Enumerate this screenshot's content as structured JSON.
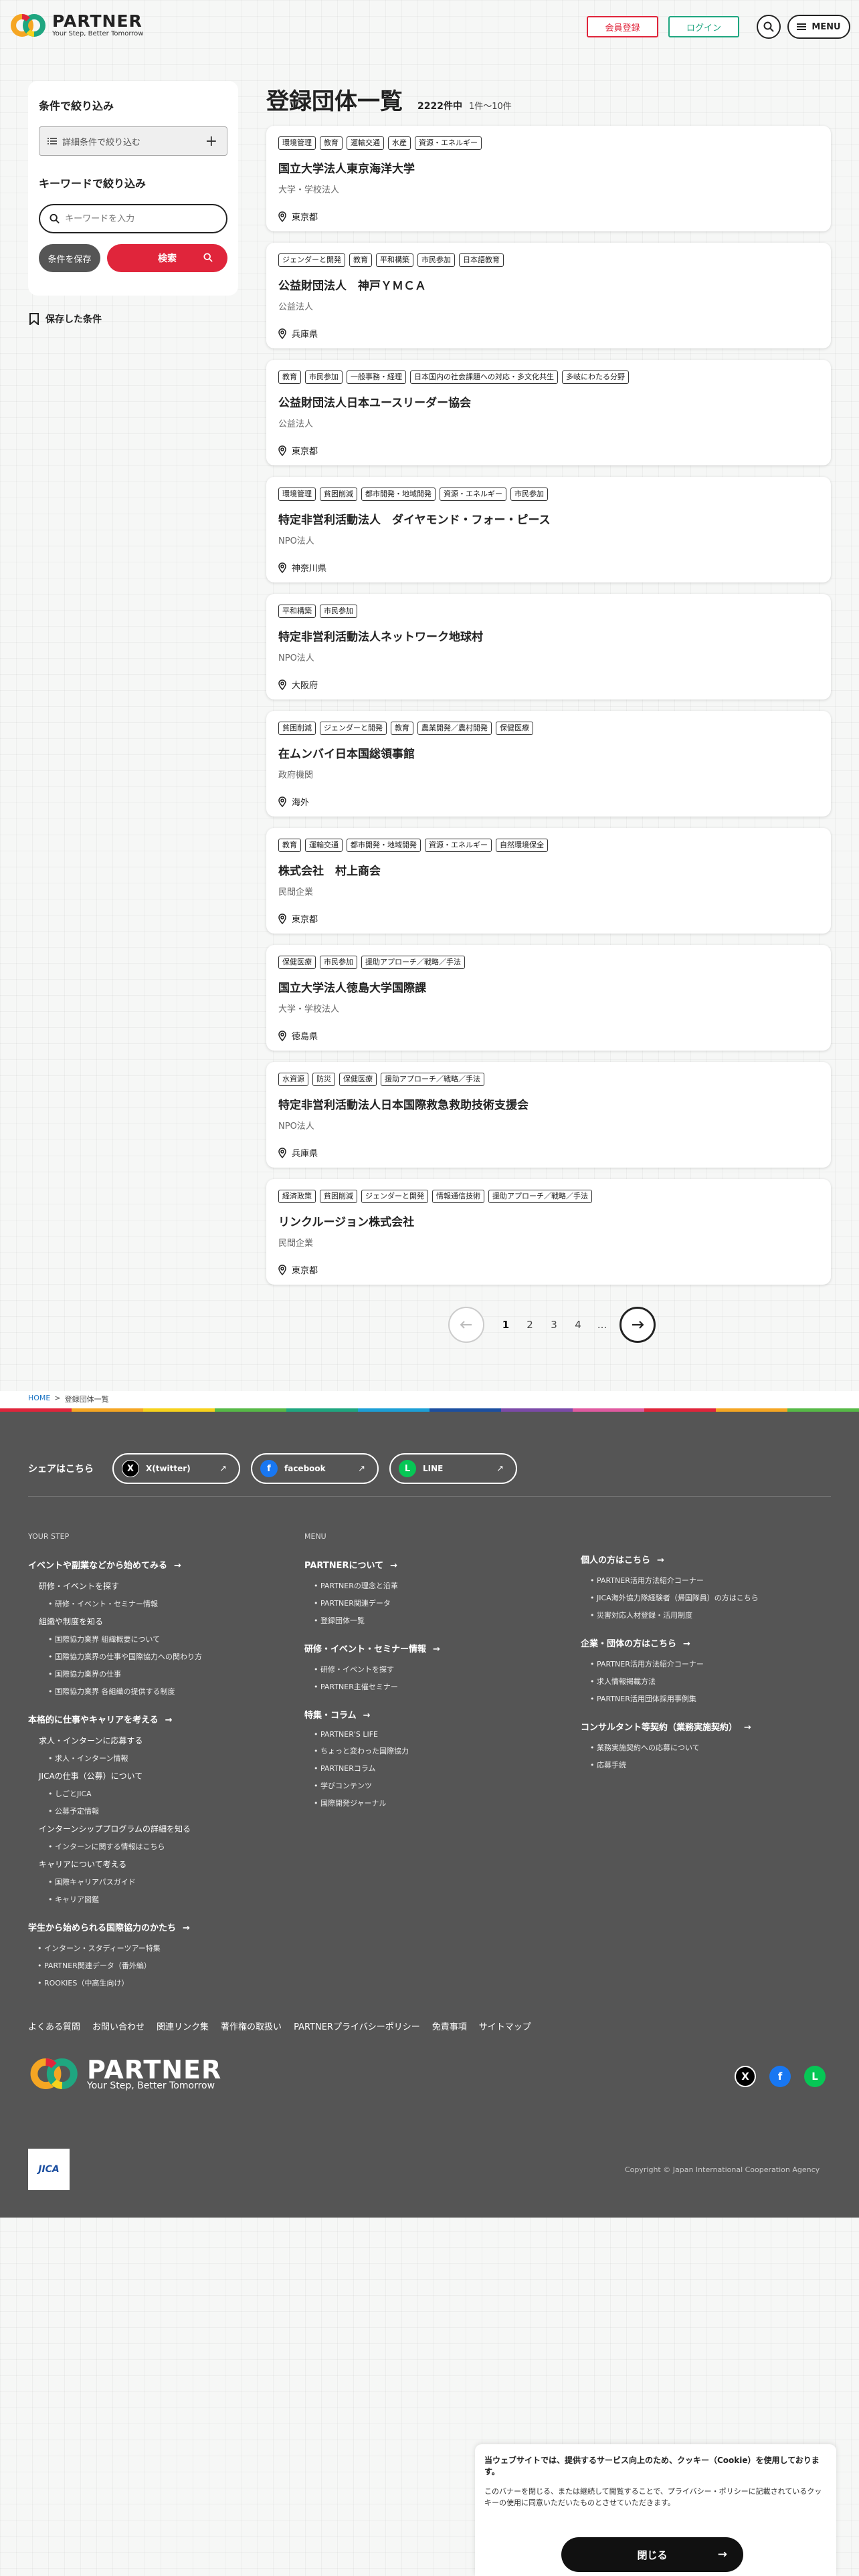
{
  "brand": {
    "name": "PARTNER",
    "tagline": "Your Step, Better Tomorrow"
  },
  "header": {
    "register_label": "会員登録",
    "login_label": "ログイン",
    "menu_label": "MENU"
  },
  "sidebar": {
    "filter_title": "条件で絞り込み",
    "detail_label": "詳細条件で絞り込む",
    "keyword_title": "キーワードで絞り込み",
    "keyword_placeholder": "キーワードを入力",
    "save_label": "条件を保存",
    "search_label": "検索",
    "saved_label": "保存した条件"
  },
  "main": {
    "title": "登録団体一覧",
    "count": "2222件中",
    "range": "1件～10件"
  },
  "cards": [
    {
      "tags": [
        "環境管理",
        "教育",
        "運輸交通",
        "水産",
        "資源・エネルギー"
      ],
      "name": "国立大学法人東京海洋大学",
      "type": "大学・学校法人",
      "location": "東京都"
    },
    {
      "tags": [
        "ジェンダーと開発",
        "教育",
        "平和構築",
        "市民参加",
        "日本語教育"
      ],
      "name": "公益財団法人　神戸ＹＭＣＡ",
      "type": "公益法人",
      "location": "兵庫県"
    },
    {
      "tags": [
        "教育",
        "市民参加",
        "一般事務・経理",
        "日本国内の社会課題への対応・多文化共生",
        "多岐にわたる分野"
      ],
      "name": "公益財団法人日本ユースリーダー協会",
      "type": "公益法人",
      "location": "東京都"
    },
    {
      "tags": [
        "環境管理",
        "貧困削減",
        "都市開発・地域開発",
        "資源・エネルギー",
        "市民参加"
      ],
      "name": "特定非営利活動法人　ダイヤモンド・フォー・ピース",
      "type": "NPO法人",
      "location": "神奈川県"
    },
    {
      "tags": [
        "平和構築",
        "市民参加"
      ],
      "name": "特定非営利活動法人ネットワーク地球村",
      "type": "NPO法人",
      "location": "大阪府"
    },
    {
      "tags": [
        "貧困削減",
        "ジェンダーと開発",
        "教育",
        "農業開発／農村開発",
        "保健医療"
      ],
      "name": "在ムンバイ日本国総領事館",
      "type": "政府機関",
      "location": "海外"
    },
    {
      "tags": [
        "教育",
        "運輸交通",
        "都市開発・地域開発",
        "資源・エネルギー",
        "自然環境保全"
      ],
      "name": "株式会社　村上商会",
      "type": "民間企業",
      "location": "東京都"
    },
    {
      "tags": [
        "保健医療",
        "市民参加",
        "援助アプローチ／戦略／手法"
      ],
      "name": "国立大学法人徳島大学国際課",
      "type": "大学・学校法人",
      "location": "徳島県"
    },
    {
      "tags": [
        "水資源",
        "防災",
        "保健医療",
        "援助アプローチ／戦略／手法"
      ],
      "name": "特定非営利活動法人日本国際救急救助技術支援会",
      "type": "NPO法人",
      "location": "兵庫県"
    },
    {
      "tags": [
        "経済政策",
        "貧困削減",
        "ジェンダーと開発",
        "情報通信技術",
        "援助アプローチ／戦略／手法"
      ],
      "name": "リンクルージョン株式会社",
      "type": "民間企業",
      "location": "東京都"
    }
  ],
  "pagination": {
    "pages": [
      "1",
      "2",
      "3",
      "4"
    ],
    "ellipsis": "...",
    "current": "1"
  },
  "breadcrumb": {
    "home": "HOME",
    "sep": ">",
    "current": "登録団体一覧"
  },
  "rainbow_colors": [
    "#e0253b",
    "#f5a623",
    "#f7d21c",
    "#56b947",
    "#1fa680",
    "#1c9fd6",
    "#1c4fa0",
    "#7b4aa8",
    "#e05aa0",
    "#e0253b",
    "#f5a623",
    "#56b947"
  ],
  "footer": {
    "share_label": "シェアはこちら",
    "share": [
      {
        "label": "X(twitter)",
        "icon": "X",
        "color": "#000000"
      },
      {
        "label": "facebook",
        "icon": "f",
        "color": "#1877f2"
      },
      {
        "label": "LINE",
        "icon": "L",
        "color": "#06c755"
      }
    ],
    "col1": {
      "label": "YOUR STEP",
      "h1": "イベントや副業などから始めてみる",
      "s1": "研修・イベントを探す",
      "i1": "研修・イベント・セミナー情報",
      "s2": "組織や制度を知る",
      "i2": "国際協力業界 組織概要について",
      "i3": "国際協力業界の仕事や国際協力への関わり方",
      "i4": "国際協力業界の仕事",
      "i5": "国際協力業界 各組織の提供する制度",
      "h2": "本格的に仕事やキャリアを考える",
      "s3": "求人・インターンに応募する",
      "i6": "求人・インターン情報",
      "s4": "JICAの仕事（公募）について",
      "i7": "しごとJICA",
      "i8": "公募予定情報",
      "s5": "インターンシッププログラムの詳細を知る",
      "i9": "インターンに関する情報はこちら",
      "s6": "キャリアについて考える",
      "i10": "国際キャリアパスガイド",
      "i11": "キャリア図鑑",
      "h3": "学生から始められる国際協力のかたち",
      "i12": "インターン・スタディーツアー特集",
      "i13": "PARTNER関連データ（番外編）",
      "i14": "ROOKIES（中高生向け）"
    },
    "col2": {
      "label": "MENU",
      "h1": "PARTNERについて",
      "i1": "PARTNERの理念と沿革",
      "i2": "PARTNER関連データ",
      "i3": "登録団体一覧",
      "h2": "研修・イベント・セミナー情報",
      "i4": "研修・イベントを探す",
      "i5": "PARTNER主催セミナー",
      "h3": "特集・コラム",
      "i6": "PARTNER'S LIFE",
      "i7": "ちょっと変わった国際協力",
      "i8": "PARTNERコラム",
      "i9": "学びコンテンツ",
      "i10": "国際開発ジャーナル"
    },
    "col3": {
      "h1": "個人の方はこちら",
      "i1": "PARTNER活用方法紹介コーナー",
      "i2": "JICA海外協力隊経験者（帰国隊員）の方はこちら",
      "i3": "災害対応人材登録・活用制度",
      "h2": "企業・団体の方はこちら",
      "i4": "PARTNER活用方法紹介コーナー",
      "i5": "求人情報掲載方法",
      "i6": "PARTNER活用団体採用事例集",
      "h3": "コンサルタント等契約（業務実施契約）",
      "i7": "業務実施契約への応募について",
      "i8": "応募手続"
    },
    "links": [
      "よくある質問",
      "お問い合わせ",
      "関連リンク集",
      "著作権の取扱い",
      "PARTNERプライバシーポリシー",
      "免責事項",
      "サイトマップ"
    ],
    "jica": "JICA",
    "copyright": "Copyright © Japan International Cooperation Agency"
  },
  "cookie": {
    "title": "当ウェブサイトでは、提供するサービス向上のため、クッキー（Cookie）を使用しております。",
    "body": "このバナーを閉じる、または継続して閲覧することで、プライバシー・ポリシーに記載されているクッキーの使用に同意いただいたものとさせていただきます。",
    "close_label": "閉じる"
  }
}
